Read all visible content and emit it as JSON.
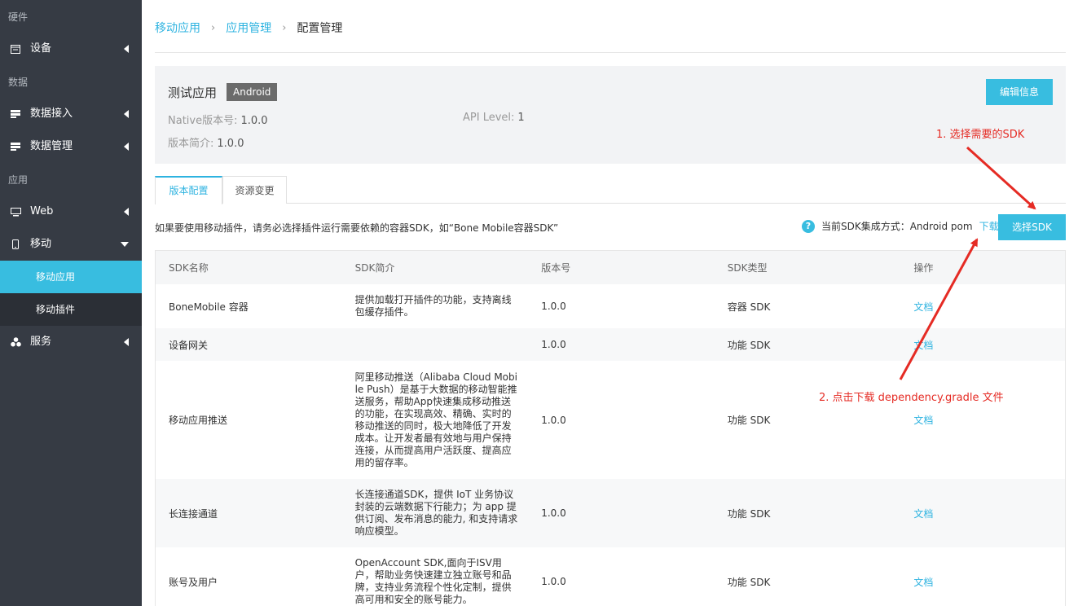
{
  "sidebar": {
    "sections": [
      {
        "label": "硬件",
        "items": [
          {
            "label": "设备",
            "icon": "device-icon"
          }
        ]
      },
      {
        "label": "数据",
        "items": [
          {
            "label": "数据接入",
            "icon": "data-input-icon"
          },
          {
            "label": "数据管理",
            "icon": "data-manage-icon"
          }
        ]
      },
      {
        "label": "应用",
        "items": [
          {
            "label": "Web",
            "icon": "monitor-icon"
          },
          {
            "label": "移动",
            "icon": "mobile-icon",
            "expanded": true
          }
        ]
      }
    ],
    "sub_items": [
      {
        "label": "移动应用",
        "active": true
      },
      {
        "label": "移动插件",
        "active": false
      }
    ],
    "service": {
      "label": "服务",
      "icon": "service-icon"
    }
  },
  "breadcrumb": [
    "移动应用",
    "应用管理",
    "配置管理"
  ],
  "app_info": {
    "name": "测试应用",
    "platform": "Android",
    "native_version_label": "Native版本号:",
    "native_version": "1.0.0",
    "api_level_label": "API Level:",
    "api_level": "1",
    "version_desc_label": "版本简介:",
    "version_desc": "1.0.0",
    "edit_button": "编辑信息"
  },
  "tabs": [
    {
      "label": "版本配置",
      "active": true
    },
    {
      "label": "资源变更",
      "active": false
    }
  ],
  "hint_text": "如果要使用移动插件，请务必选择插件运行需要依赖的容器SDK，如“Bone Mobile容器SDK”",
  "sdk_mode": {
    "label": "当前SDK集成方式：Android pom",
    "download": "下载"
  },
  "select_sdk_button": "选择SDK",
  "table": {
    "headers": [
      "SDK名称",
      "SDK简介",
      "版本号",
      "SDK类型",
      "操作"
    ],
    "rows": [
      {
        "name": "BoneMobile 容器",
        "desc": "提供加载打开插件的功能，支持离线包缓存插件。",
        "version": "1.0.0",
        "type": "容器 SDK",
        "action": "文档"
      },
      {
        "name": "设备网关",
        "desc": "",
        "version": "1.0.0",
        "type": "功能 SDK",
        "action": "文档"
      },
      {
        "name": "移动应用推送",
        "desc": "阿里移动推送（Alibaba Cloud Mobile Push）是基于大数据的移动智能推送服务，帮助App快速集成移动推送的功能，在实现高效、精确、实时的移动推送的同时，极大地降低了开发成本。让开发者最有效地与用户保持连接，从而提高用户活跃度、提高应用的留存率。",
        "version": "1.0.0",
        "type": "功能 SDK",
        "action": "文档"
      },
      {
        "name": "长连接通道",
        "desc": "长连接通道SDK，提供 IoT 业务协议封装的云端数据下行能力；为 app 提供订阅、发布消息的能力, 和支持请求响应模型。",
        "version": "1.0.0",
        "type": "功能 SDK",
        "action": "文档"
      },
      {
        "name": "账号及用户",
        "desc": "OpenAccount SDK,面向于ISV用户，帮助业务快速建立独立账号和品牌，支持业务流程个性化定制，提供高可用和安全的账号能力。",
        "version": "1.0.0",
        "type": "功能 SDK",
        "action": "文档"
      }
    ]
  },
  "annotations": {
    "step1": "1. 选择需要的SDK",
    "step2": "2. 点击下载 dependency.gradle 文件",
    "color": "#e52b24"
  },
  "colors": {
    "accent": "#38bde0",
    "sidebar": "#363b44",
    "sidebar_sub": "#2b2f36"
  }
}
